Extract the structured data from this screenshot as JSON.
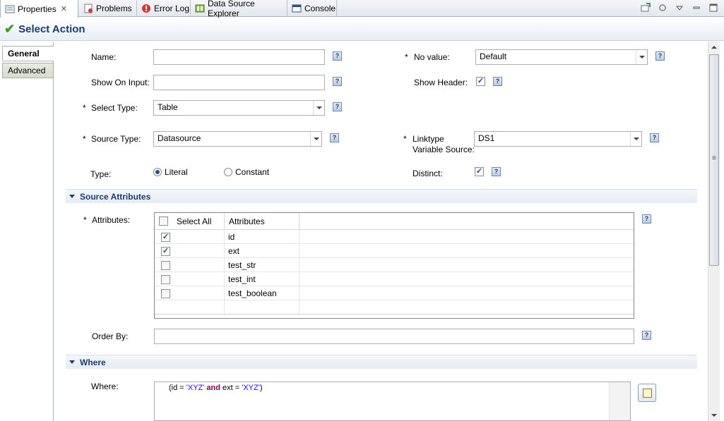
{
  "tabs": [
    {
      "label": "Properties",
      "icon": "properties-icon",
      "active": true
    },
    {
      "label": "Problems",
      "icon": "problems-icon"
    },
    {
      "label": "Error Log",
      "icon": "error-log-icon"
    },
    {
      "label": "Data Source Explorer",
      "icon": "data-source-explorer-icon"
    },
    {
      "label": "Console",
      "icon": "console-icon"
    }
  ],
  "title": "Select Action",
  "side_tabs": {
    "general": "General",
    "advanced": "Advanced"
  },
  "form": {
    "name_label": "Name:",
    "name_value": "",
    "show_on_input_label": "Show On Input:",
    "show_on_input_value": "",
    "select_type_label": "Select Type:",
    "select_type_value": "Table",
    "source_type_label": "Source Type:",
    "source_type_value": "Datasource",
    "type_label": "Type:",
    "type_literal": "Literal",
    "type_constant": "Constant",
    "no_value_label": "No value:",
    "no_value_value": "Default",
    "show_header_label": "Show Header:",
    "linktype_label_1": "Linktype",
    "linktype_label_2": "Variable Source:",
    "linktype_value": "DS1",
    "distinct_label": "Distinct:",
    "required_mark": "*",
    "help_glyph": "?"
  },
  "source_attributes": {
    "section_title": "Source Attributes",
    "attributes_label": "Attributes:",
    "header_select_all": "Select All",
    "header_attributes": "Attributes",
    "rows": [
      {
        "name": "id",
        "checked": true
      },
      {
        "name": "ext",
        "checked": true
      },
      {
        "name": "test_str",
        "checked": false
      },
      {
        "name": "test_int",
        "checked": false
      },
      {
        "name": "test_boolean",
        "checked": false
      }
    ],
    "order_by_label": "Order By:",
    "order_by_value": ""
  },
  "where": {
    "section_title": "Where",
    "where_label": "Where:",
    "tokens": [
      {
        "t": "(id = ",
        "c": "plain"
      },
      {
        "t": "'XYZ'",
        "c": "str"
      },
      {
        "t": " and ",
        "c": "kw"
      },
      {
        "t": "ext = ",
        "c": "plain"
      },
      {
        "t": "'XYZ'",
        "c": "str"
      },
      {
        "t": ")",
        "c": "plain"
      }
    ]
  },
  "colors": {
    "accent": "#1a3c6e",
    "check": "#3a9a2c",
    "keyword": "#7f0055",
    "string": "#2a00ff"
  }
}
